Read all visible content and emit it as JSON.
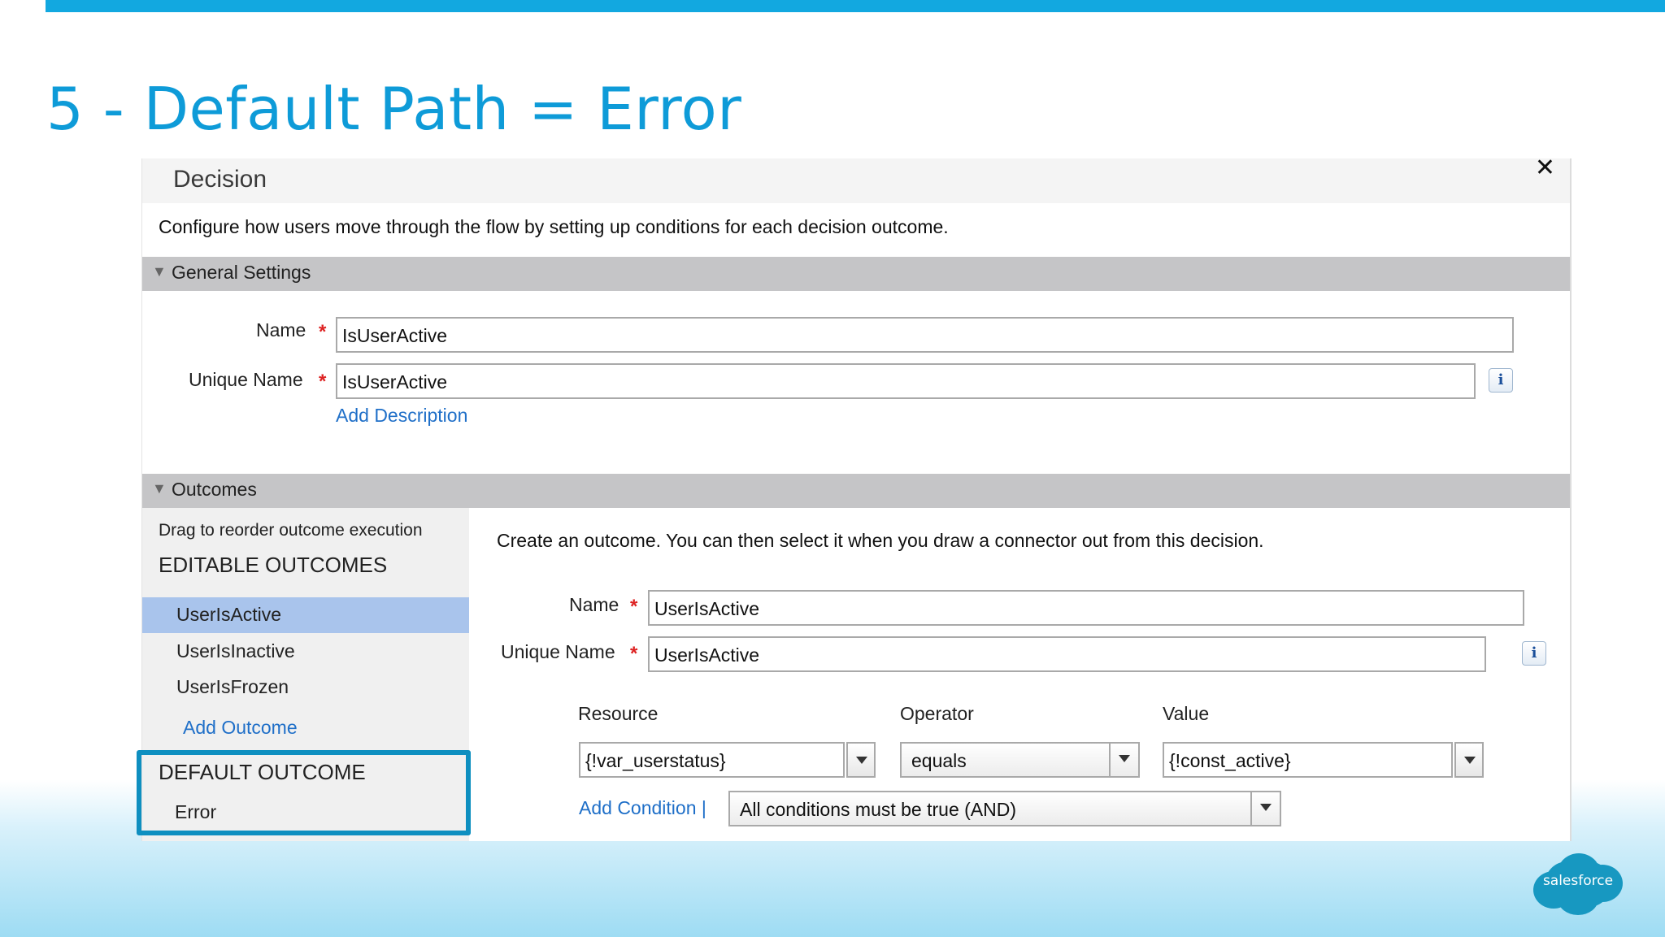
{
  "slide": {
    "title": "5 - Default Path = Error",
    "accent_color": "#0e9bd8",
    "logo_text": "salesforce"
  },
  "dialog": {
    "title": "Decision",
    "close_icon": "close-icon",
    "description": "Configure how users move through the flow by setting up conditions for each decision outcome."
  },
  "general_settings": {
    "header": "General Settings",
    "name_label": "Name",
    "name_value": "IsUserActive",
    "unique_name_label": "Unique Name",
    "unique_name_value": "IsUserActive",
    "required_mark": "*",
    "info_glyph": "i",
    "add_description": "Add Description"
  },
  "outcomes": {
    "header": "Outcomes",
    "drag_hint": "Drag to reorder outcome execution",
    "editable_heading": "EDITABLE OUTCOMES",
    "items": [
      {
        "label": "UserIsActive",
        "selected": true
      },
      {
        "label": "UserIsInactive",
        "selected": false
      },
      {
        "label": "UserIsFrozen",
        "selected": false
      }
    ],
    "add_outcome": "Add Outcome",
    "default_heading": "DEFAULT OUTCOME",
    "default_item": "Error",
    "highlight_color": "#0e8fc0"
  },
  "outcome_detail": {
    "intro": "Create an outcome.  You can then select it when you draw a connector out from this decision.",
    "name_label": "Name",
    "name_value": "UserIsActive",
    "unique_name_label": "Unique Name",
    "unique_name_value": "UserIsActive",
    "condition": {
      "resource_heading": "Resource",
      "operator_heading": "Operator",
      "value_heading": "Value",
      "resource_value": "{!var_userstatus}",
      "operator_value": "equals",
      "value_value": "{!const_active}"
    },
    "add_condition": "Add Condition |",
    "logic_value": "All conditions must be true (AND)"
  }
}
